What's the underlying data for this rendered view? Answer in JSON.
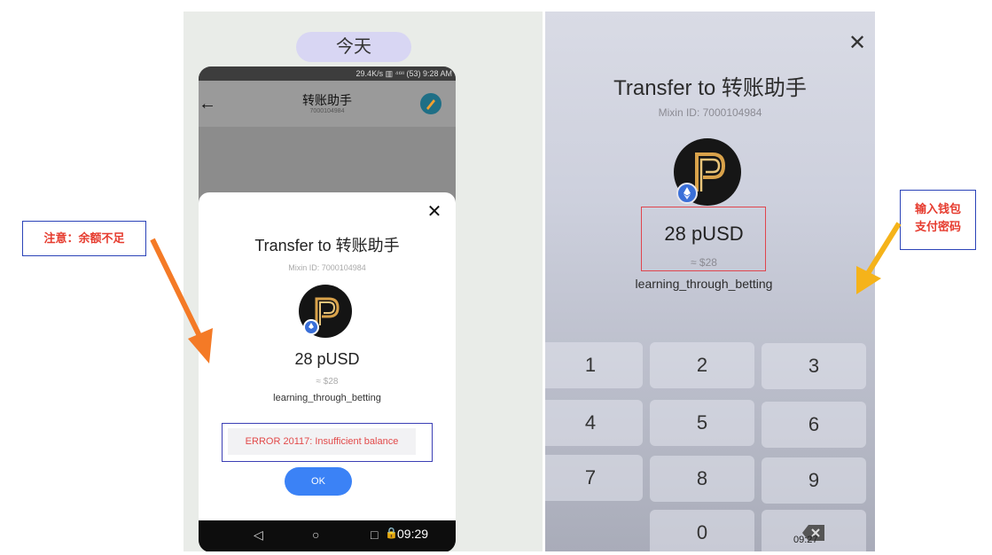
{
  "left_panel": {
    "date_pill": "今天",
    "phone": {
      "status_bar": "29.4K/s ▥ ⁴⁶ᶦᶦ (53) 9:28 AM",
      "header": {
        "title": "转账助手",
        "subtitle": "7000104984"
      },
      "sheet": {
        "title": "Transfer to 转账助手",
        "mixin_id": "Mixin ID: 7000104984",
        "amount": "28 pUSD",
        "usd_value": "≈ $28",
        "memo": "learning_through_betting",
        "error": "ERROR 20117: Insufficient balance",
        "ok_label": "OK"
      },
      "navbar": {
        "back": "◁",
        "home": "○",
        "recents": "□",
        "time": "09:29"
      }
    }
  },
  "right_panel": {
    "title": "Transfer to 转账助手",
    "mixin_id": "Mixin ID: 7000104984",
    "amount": "28 pUSD",
    "usd_value": "≈ $28",
    "memo": "learning_through_betting",
    "keypad": [
      "1",
      "2",
      "3",
      "4",
      "5",
      "6",
      "7",
      "8",
      "9",
      "0"
    ],
    "time": "09:27"
  },
  "annotations": {
    "left_note": "注意：余额不足",
    "right_note_line1": "输入钱包",
    "right_note_line2": "支付密码"
  },
  "colors": {
    "accent_blue": "#3b82f6",
    "error_red": "#e24a4a",
    "arrow_orange": "#f47a26",
    "arrow_yellow": "#f5b31a",
    "annotation_border": "#2b43b8"
  }
}
